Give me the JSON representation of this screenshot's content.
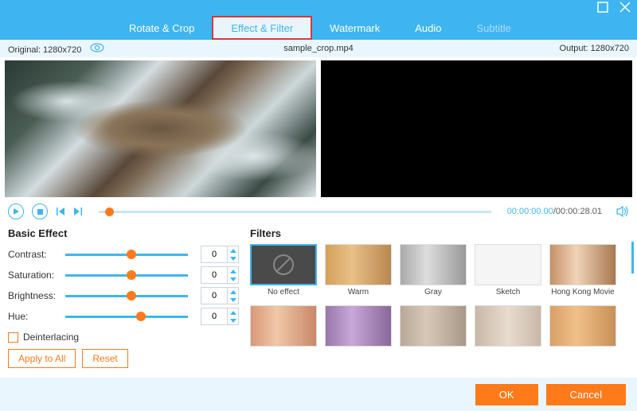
{
  "window": {
    "maximize": "maximize",
    "close": "close"
  },
  "tabs": {
    "rotate": "Rotate & Crop",
    "effect": "Effect & Filter",
    "watermark": "Watermark",
    "audio": "Audio",
    "subtitle": "Subtitle"
  },
  "info": {
    "original_label": "Original: 1280x720",
    "filename": "sample_crop.mp4",
    "output_label": "Output: 1280x720"
  },
  "playback": {
    "current": "00:00:00.00",
    "sep": "/",
    "duration": "00:00:28.01"
  },
  "basic": {
    "heading": "Basic Effect",
    "contrast": {
      "label": "Contrast:",
      "value": "0",
      "pos": 50
    },
    "saturation": {
      "label": "Saturation:",
      "value": "0",
      "pos": 50
    },
    "brightness": {
      "label": "Brightness:",
      "value": "0",
      "pos": 50
    },
    "hue": {
      "label": "Hue:",
      "value": "0",
      "pos": 58
    },
    "deinterlacing": "Deinterlacing",
    "apply_all": "Apply to All",
    "reset": "Reset"
  },
  "filters": {
    "heading": "Filters",
    "items": {
      "none": "No effect",
      "warm": "Warm",
      "gray": "Gray",
      "sketch": "Sketch",
      "hk": "Hong Kong Movie"
    }
  },
  "footer": {
    "ok": "OK",
    "cancel": "Cancel"
  }
}
